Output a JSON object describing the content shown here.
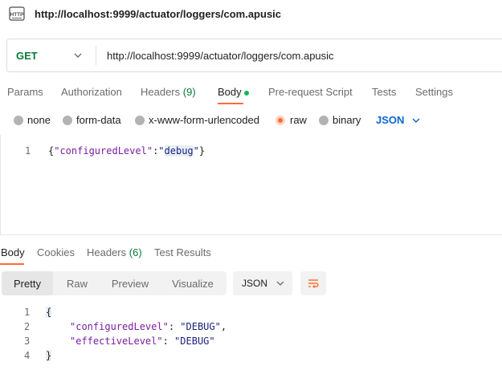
{
  "window": {
    "title": "http://localhost:9999/actuator/loggers/com.apusic"
  },
  "request": {
    "method": "GET",
    "url": "http://localhost:9999/actuator/loggers/com.apusic",
    "tabs": [
      {
        "label": "Params"
      },
      {
        "label": "Authorization"
      },
      {
        "label": "Headers",
        "count": "(9)"
      },
      {
        "label": "Body"
      },
      {
        "label": "Pre-request Script"
      },
      {
        "label": "Tests"
      },
      {
        "label": "Settings"
      }
    ],
    "active_tab": "Body",
    "body_types": [
      {
        "label": "none"
      },
      {
        "label": "form-data"
      },
      {
        "label": "x-www-form-urlencoded"
      },
      {
        "label": "raw"
      },
      {
        "label": "binary"
      }
    ],
    "selected_body_type": "raw",
    "format": "JSON",
    "body_lines": [
      {
        "num": "1",
        "open": "{",
        "key": "\"configuredLevel\"",
        "colon": ":",
        "q1": "\"",
        "value": "debug",
        "q2": "\"",
        "close": "}"
      }
    ]
  },
  "response": {
    "tabs": [
      {
        "label": "Body"
      },
      {
        "label": "Cookies"
      },
      {
        "label": "Headers",
        "count": "(6)"
      },
      {
        "label": "Test Results"
      }
    ],
    "active_tab": "Body",
    "views": [
      {
        "label": "Pretty"
      },
      {
        "label": "Raw"
      },
      {
        "label": "Preview"
      },
      {
        "label": "Visualize"
      }
    ],
    "active_view": "Pretty",
    "format": "JSON",
    "lines": [
      {
        "num": "1",
        "text": "{"
      },
      {
        "num": "2",
        "key": "\"configuredLevel\"",
        "sep": ": ",
        "value": "\"DEBUG\"",
        "tail": ","
      },
      {
        "num": "3",
        "key": "\"effectiveLevel\"",
        "sep": ": ",
        "value": "\"DEBUG\"",
        "tail": ""
      },
      {
        "num": "4",
        "text": "}"
      }
    ]
  },
  "colors": {
    "accent": "#ff6c37",
    "method_get": "#0b7a3b",
    "link_blue": "#0a67d1",
    "count_green": "#0b7a3b"
  }
}
